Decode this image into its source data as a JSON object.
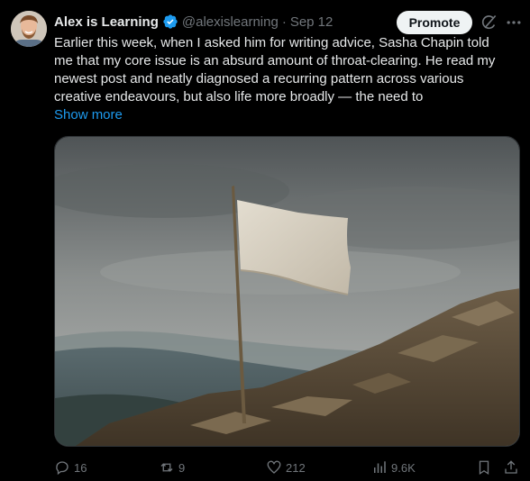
{
  "author": {
    "name": "Alex is Learning",
    "handle": "@alexislearning",
    "separator": "·",
    "date": "Sep 12",
    "verified": true
  },
  "promote_label": "Promote",
  "icons": {
    "avatar": "avatar",
    "verified": "verified-badge-icon",
    "grok": "grok-icon",
    "more": "more-icon",
    "reply": "reply-icon",
    "retweet": "retweet-icon",
    "like": "heart-icon",
    "views": "analytics-icon",
    "bookmark": "bookmark-icon",
    "share": "share-icon"
  },
  "tweet": {
    "lines": [
      "Earlier this week, when I asked him for writing advice, Sasha Chapin  told",
      "me that my core issue is an absurd amount of throat-clearing. He  read my",
      "newest post and neatly diagnosed a recurring pattern across  various",
      "creative endeavours, but also life more broadly — the need to"
    ],
    "show_more": "Show more"
  },
  "metrics": {
    "replies": "16",
    "retweets": "9",
    "likes": "212",
    "views": "9.6K"
  },
  "colors": {
    "background": "#000000",
    "text": "#e7e9ea",
    "muted": "#71767b",
    "link": "#1d9bf0",
    "verified": "#1d9bf0"
  }
}
